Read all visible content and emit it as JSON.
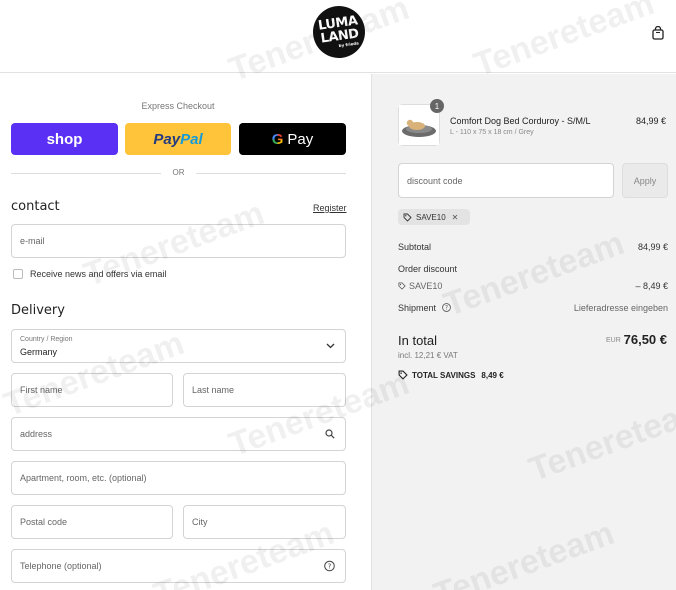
{
  "header": {
    "logo_line1": "LUMA",
    "logo_line2": "LAND",
    "logo_sub": "by frieda"
  },
  "checkout": {
    "express_label": "Express Checkout",
    "shop_pay_label": "shop",
    "paypal_part1": "Pay",
    "paypal_part2": "Pal",
    "gpay_g": "G",
    "gpay_label": "Pay",
    "or_label": "OR"
  },
  "contact": {
    "title": "contact",
    "register_label": "Register",
    "email_placeholder": "e-mail",
    "newsletter_label": "Receive news and offers via email"
  },
  "delivery": {
    "title": "Delivery",
    "country_label": "Country / Region",
    "country_value": "Germany",
    "first_name_placeholder": "First name",
    "last_name_placeholder": "Last name",
    "address_placeholder": "address",
    "apartment_placeholder": "Apartment, room, etc. (optional)",
    "postal_placeholder": "Postal code",
    "city_placeholder": "City",
    "phone_placeholder": "Telephone (optional)"
  },
  "summary": {
    "quantity": "1",
    "product_name": "Comfort Dog Bed Corduroy - S/M/L",
    "product_variant": "L - 110 x 75 x 18 cm / Grey",
    "product_price": "84,99 €",
    "discount_placeholder": "discount code",
    "apply_label": "Apply",
    "applied_code": "SAVE10",
    "subtotal_label": "Subtotal",
    "subtotal_value": "84,99 €",
    "order_discount_label": "Order discount",
    "discount_code": "SAVE10",
    "discount_value": "– 8,49 €",
    "shipping_label": "Shipment",
    "shipping_value": "Lieferadresse eingeben",
    "total_label": "In total",
    "total_currency": "EUR",
    "total_value": "76,50 €",
    "vat_note": "incl. 12,21 € VAT",
    "savings_label": "TOTAL SAVINGS",
    "savings_value": "8,49 €"
  },
  "watermark": {
    "text": "Tenereteam"
  }
}
